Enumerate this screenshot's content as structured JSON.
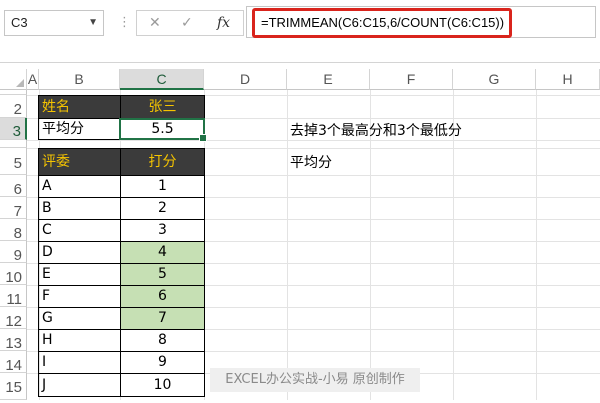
{
  "formula_bar": {
    "name_box": "C3",
    "formula": "=TRIMMEAN(C6:C15,6/COUNT(C6:C15))",
    "cancel_glyph": "✕",
    "enter_glyph": "✓",
    "fx_label": "fx"
  },
  "columns": [
    "A",
    "B",
    "C",
    "D",
    "E",
    "F",
    "G",
    "H"
  ],
  "rows": [
    "2",
    "3",
    "4",
    "5",
    "6",
    "7",
    "8",
    "9",
    "10",
    "11",
    "12",
    "13",
    "14",
    "15"
  ],
  "sheet": {
    "B2": "姓名",
    "C2": "张三",
    "B3": "平均分",
    "C3": "5.5",
    "B5": "评委",
    "C5": "打分",
    "judges": [
      {
        "name": "A",
        "score": "1"
      },
      {
        "name": "B",
        "score": "2"
      },
      {
        "name": "C",
        "score": "3"
      },
      {
        "name": "D",
        "score": "4"
      },
      {
        "name": "E",
        "score": "5"
      },
      {
        "name": "F",
        "score": "6"
      },
      {
        "name": "G",
        "score": "7"
      },
      {
        "name": "H",
        "score": "8"
      },
      {
        "name": "I",
        "score": "9"
      },
      {
        "name": "J",
        "score": "10"
      }
    ]
  },
  "notes": {
    "line1": "去掉3个最高分和3个最低分",
    "line2": "平均分"
  },
  "watermark": "EXCEL办公实战-小易 原创制作",
  "colors": {
    "header_bg": "#3b3b3b",
    "header_text": "#f5c400",
    "highlight": "#c6e0b4",
    "selection": "#217346",
    "formula_highlight": "#d9241c"
  }
}
